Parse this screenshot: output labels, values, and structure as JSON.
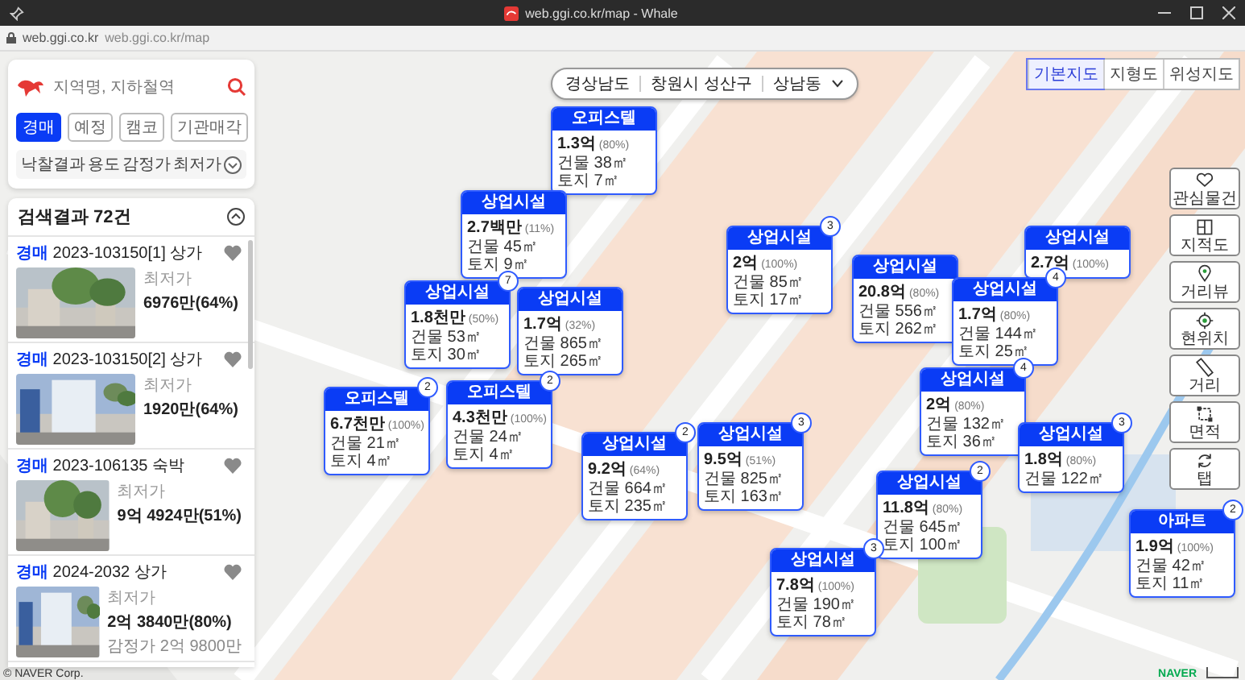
{
  "browser": {
    "title": "web.ggi.co.kr/map - Whale",
    "address_domain": "web.ggi.co.kr",
    "address_url": "web.ggi.co.kr/map"
  },
  "search": {
    "placeholder": "지역명, 지하철역"
  },
  "tabs": [
    {
      "label": "경매",
      "selected": true
    },
    {
      "label": "예정",
      "selected": false
    },
    {
      "label": "캠코",
      "selected": false
    },
    {
      "label": "기관매각",
      "selected": false
    }
  ],
  "filters": [
    "낙찰결과",
    "용도",
    "감정가",
    "최저가"
  ],
  "results": {
    "title": "검색결과 72건"
  },
  "listings": [
    {
      "type": "경매",
      "case": "2023-103150[1] 상가",
      "price_label": "최저가",
      "price": "6976만(64%)"
    },
    {
      "type": "경매",
      "case": "2023-103150[2] 상가",
      "price_label": "최저가",
      "price": "1920만(64%)"
    },
    {
      "type": "경매",
      "case": "2023-106135 숙박",
      "price_label": "최저가",
      "price": "9억 4924만(51%)"
    },
    {
      "type": "경매",
      "case": "2024-2032 상가",
      "price_label": "최저가",
      "price": "2억 3840만(80%)",
      "appraisal": "감정가 2억 9800만"
    }
  ],
  "breadcrumb": [
    "경상남도",
    "창원시 성산구",
    "상남동"
  ],
  "map_types": [
    {
      "label": "기본지도",
      "selected": true
    },
    {
      "label": "지형도",
      "selected": false
    },
    {
      "label": "위성지도",
      "selected": false
    }
  ],
  "tools": [
    "관심물건",
    "지적도",
    "거리뷰",
    "현위치",
    "거리",
    "면적",
    "탭"
  ],
  "markers": [
    {
      "type": "오피스텔",
      "price": "1.3억",
      "ratio": "(80%)",
      "building": "건물 38㎡",
      "land": "토지 7㎡"
    },
    {
      "type": "상업시설",
      "price": "2.7백만",
      "ratio": "(11%)",
      "building": "건물 45㎡",
      "land": "토지 9㎡"
    },
    {
      "type": "상업시설",
      "price": "1.8천만",
      "ratio": "(50%)",
      "building": "건물 53㎡",
      "land": "토지 30㎡",
      "count": "7"
    },
    {
      "type": "상업시설",
      "price": "1.7억",
      "ratio": "(32%)",
      "building": "건물 865㎡",
      "land": "토지 265㎡"
    },
    {
      "type": "상업시설",
      "price": "2억",
      "ratio": "(100%)",
      "building": "건물 85㎡",
      "land": "토지 17㎡",
      "count": "3"
    },
    {
      "type": "상업시설",
      "price": "2.7억",
      "ratio": "(100%)"
    },
    {
      "type": "상업시설",
      "price": "20.8억",
      "ratio": "(80%)",
      "building": "건물 556㎡",
      "land": "토지 262㎡"
    },
    {
      "type": "상업시설",
      "price": "1.7억",
      "ratio": "(80%)",
      "building": "건물 144㎡",
      "land": "토지 25㎡",
      "count": "4"
    },
    {
      "type": "상업시설",
      "price": "2억",
      "ratio": "(80%)",
      "building": "건물 132㎡",
      "land": "토지 36㎡",
      "count": "4"
    },
    {
      "type": "오피스텔",
      "price": "6.7천만",
      "ratio": "(100%)",
      "building": "건물 21㎡",
      "land": "토지 4㎡",
      "count": "2"
    },
    {
      "type": "오피스텔",
      "price": "4.3천만",
      "ratio": "(100%)",
      "building": "건물 24㎡",
      "land": "토지 4㎡",
      "count": "2"
    },
    {
      "type": "상업시설",
      "price": "9.2억",
      "ratio": "(64%)",
      "building": "건물 664㎡",
      "land": "토지 235㎡",
      "count": "2"
    },
    {
      "type": "상업시설",
      "price": "9.5억",
      "ratio": "(51%)",
      "building": "건물 825㎡",
      "land": "토지 163㎡",
      "count": "3"
    },
    {
      "type": "상업시설",
      "price": "1.8억",
      "ratio": "(80%)",
      "building": "건물 122㎡",
      "count": "3"
    },
    {
      "type": "상업시설",
      "price": "11.8억",
      "ratio": "(80%)",
      "building": "건물 645㎡",
      "land": "토지 100㎡",
      "count": "2"
    },
    {
      "type": "상업시설",
      "price": "7.8억",
      "ratio": "(100%)",
      "building": "건물 190㎡",
      "land": "토지 78㎡",
      "count": "3"
    },
    {
      "type": "아파트",
      "price": "1.9억",
      "ratio": "(100%)",
      "building": "건물 42㎡",
      "land": "토지 11㎡",
      "count": "2"
    }
  ],
  "copyright": "© NAVER Corp.",
  "map_logo": "NAVER"
}
